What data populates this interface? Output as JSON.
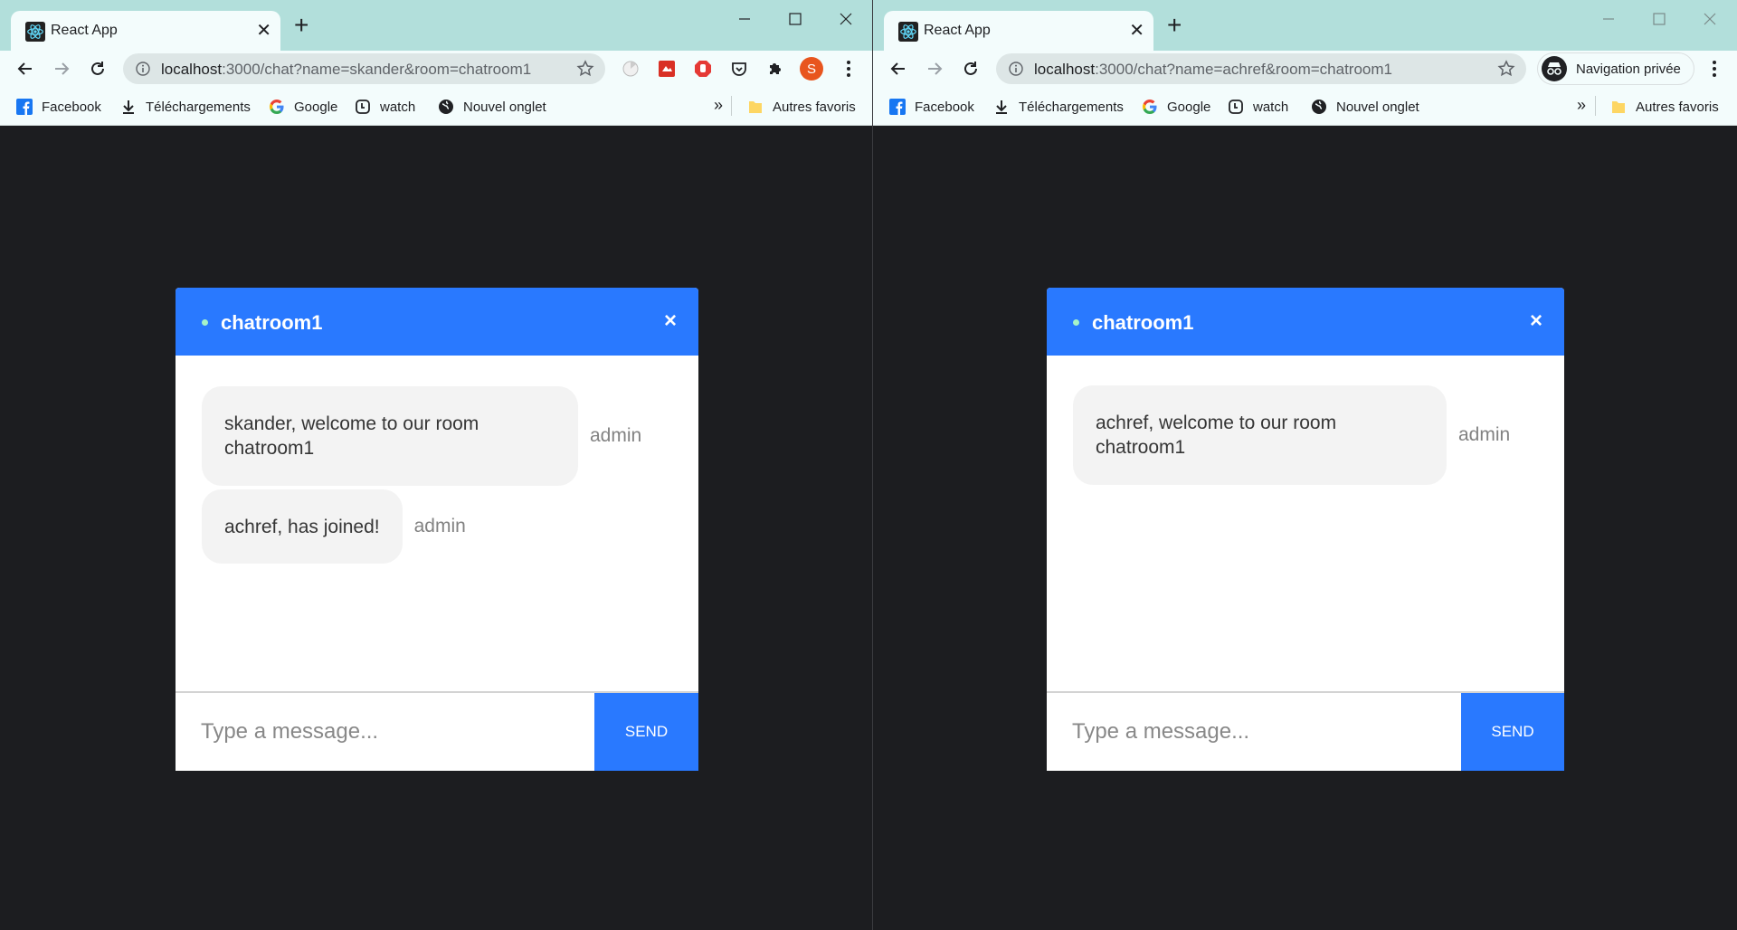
{
  "colors": {
    "accent": "#2979ff",
    "titlebar": "#b2dfdb",
    "toolbar": "#f3fcfc",
    "page_bg": "#1c1d20",
    "online_dot": "#a6f3c9",
    "bubble_bg": "#f3f3f3",
    "profile": "#e8551e"
  },
  "left_window": {
    "tab": {
      "title": "React App",
      "icon": "react-icon"
    },
    "url": {
      "host": "localhost",
      "rest": ":3000/chat?name=skander&room=chatroom1"
    },
    "extensions": [
      "pie-timer-icon",
      "red-extension-icon",
      "stop-hand-icon",
      "pocket-icon",
      "puzzle-icon"
    ],
    "profile_initial": "S",
    "bookmarks": [
      "Facebook",
      "Téléchargements",
      "Google",
      "watch",
      "Nouvel onglet"
    ],
    "more_bookmarks": "»",
    "other_bookmarks": "Autres favoris",
    "chat": {
      "room": "chatroom1",
      "close": "×",
      "messages": [
        {
          "text": "skander, welcome to our room chatroom1",
          "sender": "admin"
        },
        {
          "text": "achref, has joined!",
          "sender": "admin"
        }
      ],
      "input_placeholder": "Type a message...",
      "send_label": "SEND"
    }
  },
  "right_window": {
    "tab": {
      "title": "React App",
      "icon": "react-icon"
    },
    "url": {
      "host": "localhost",
      "rest": ":3000/chat?name=achref&room=chatroom1"
    },
    "incognito_label": "Navigation privée",
    "bookmarks": [
      "Facebook",
      "Téléchargements",
      "Google",
      "watch",
      "Nouvel onglet"
    ],
    "more_bookmarks": "»",
    "other_bookmarks": "Autres favoris",
    "chat": {
      "room": "chatroom1",
      "close": "×",
      "messages": [
        {
          "text": "achref, welcome to our room chatroom1",
          "sender": "admin"
        }
      ],
      "input_placeholder": "Type a message...",
      "send_label": "SEND"
    }
  }
}
